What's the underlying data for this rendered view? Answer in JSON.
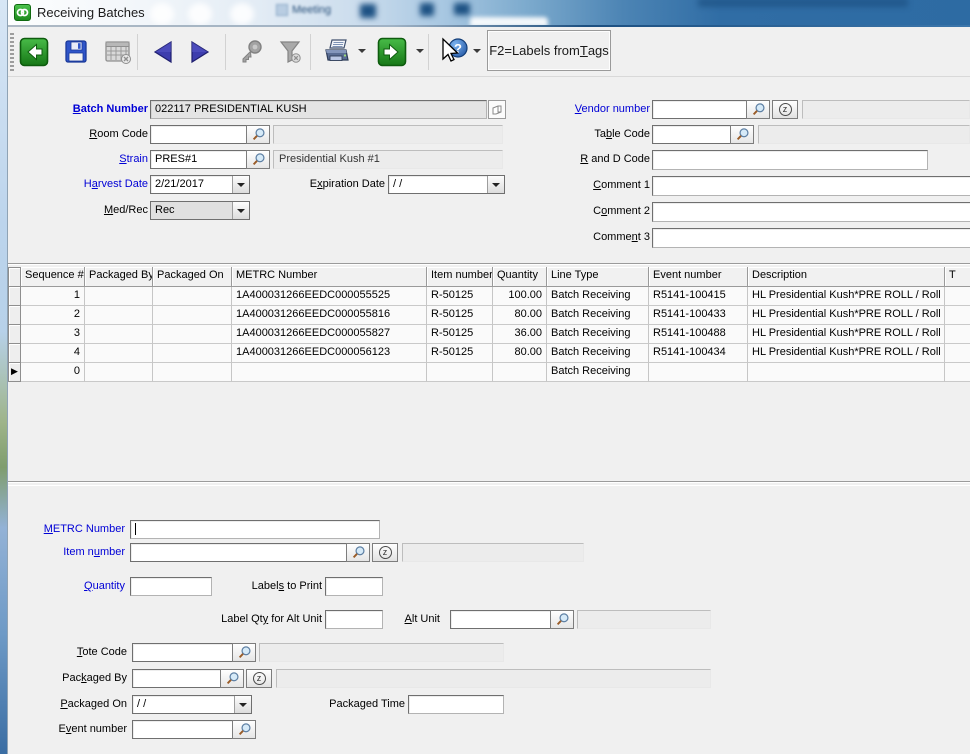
{
  "window": {
    "title": "Receiving Batches"
  },
  "background_window": {
    "label": "Meeting"
  },
  "colors": {
    "label_blue": "#0000d6",
    "titlebar_blue": "#2d6ba3",
    "toolbar_green": "#1d8a1d",
    "nav_triangle_blue": "#3d3dae",
    "disabled_gray": "#9a9a9a",
    "window_bg": "#f0f0f0"
  },
  "toolbar": {
    "f2_label": "F2=Labels from &Tags",
    "buttons": [
      {
        "icon": "back-icon",
        "enabled": true
      },
      {
        "icon": "save-icon",
        "enabled": true
      },
      {
        "icon": "calendar-delete-icon",
        "enabled": false
      },
      {
        "icon": "previous-record-icon",
        "enabled": true
      },
      {
        "icon": "next-record-icon",
        "enabled": true
      },
      {
        "icon": "key-search-icon",
        "enabled": false
      },
      {
        "icon": "filter-icon",
        "enabled": false
      },
      {
        "icon": "print-icon",
        "enabled": true,
        "has_dropdown": true
      },
      {
        "icon": "go-icon",
        "enabled": true,
        "has_dropdown": true
      },
      {
        "icon": "help-select-icon",
        "enabled": true,
        "has_dropdown": true
      }
    ]
  },
  "form_top": {
    "batch_number": {
      "label": "&Batch Number",
      "value": "022117 PRESIDENTIAL KUSH"
    },
    "room_code": {
      "label": "&Room Code",
      "value": "",
      "description": ""
    },
    "strain": {
      "label": "&Strain",
      "value": "PRES#1",
      "description": "Presidential Kush #1"
    },
    "harvest_date": {
      "label": "H&arvest Date",
      "value": "2/21/2017"
    },
    "expiration_date": {
      "label": "E&xpiration Date",
      "value": "/ /"
    },
    "med_rec": {
      "label": "&Med/Rec",
      "value": "Rec"
    },
    "vendor_number": {
      "label": "&Vendor number",
      "value": "",
      "description": ""
    },
    "table_code": {
      "label": "Ta&ble Code",
      "value": "",
      "description": ""
    },
    "r_and_d_code": {
      "label": "&R and D Code",
      "value": ""
    },
    "comment_1": {
      "label": "&Comment 1",
      "value": ""
    },
    "comment_2": {
      "label": "C&omment 2",
      "value": ""
    },
    "comment_3": {
      "label": "Comme&nt 3",
      "value": ""
    }
  },
  "grid": {
    "columns": [
      "Sequence #",
      "Packaged By",
      "Packaged On",
      "METRC Number",
      "Item number",
      "Quantity",
      "Line Type",
      "Event number",
      "Description",
      "T"
    ],
    "current_row_index": 4,
    "current_row_marker": "▶",
    "rows": [
      [
        "1",
        "",
        "",
        "1A400031266EEDC000055525",
        "R-50125",
        "100.00",
        "Batch Receiving",
        "R5141-100415",
        "HL Presidential Kush*PRE ROLL  / Roll",
        ""
      ],
      [
        "2",
        "",
        "",
        "1A400031266EEDC000055816",
        "R-50125",
        "80.00",
        "Batch Receiving",
        "R5141-100433",
        "HL Presidential Kush*PRE ROLL  / Roll",
        ""
      ],
      [
        "3",
        "",
        "",
        "1A400031266EEDC000055827",
        "R-50125",
        "36.00",
        "Batch Receiving",
        "R5141-100488",
        "HL Presidential Kush*PRE ROLL  / Roll",
        ""
      ],
      [
        "4",
        "",
        "",
        "1A400031266EEDC000056123",
        "R-50125",
        "80.00",
        "Batch Receiving",
        "R5141-100434",
        "HL Presidential Kush*PRE ROLL  / Roll",
        ""
      ],
      [
        "0",
        "",
        "",
        "",
        "",
        "",
        "Batch Receiving",
        "",
        "",
        ""
      ]
    ]
  },
  "form_bottom": {
    "metrc_number": {
      "label": "&METRC Number",
      "value": ""
    },
    "item_number": {
      "label": "Item n&umber",
      "value": "",
      "description": ""
    },
    "quantity": {
      "label": "&Quantity",
      "value": ""
    },
    "labels_to_print": {
      "label": "Label&s to Print",
      "value": ""
    },
    "label_qty_alt": {
      "label": "Label Qt&y for Alt Unit",
      "value": ""
    },
    "alt_unit": {
      "label": "&Alt Unit",
      "value": "",
      "description": ""
    },
    "tote_code": {
      "label": "&Tote Code",
      "value": "",
      "description": ""
    },
    "packaged_by": {
      "label": "Pac&kaged By",
      "value": "",
      "description": ""
    },
    "packaged_on": {
      "label": "&Packaged On",
      "value": "/ /"
    },
    "packaged_time": {
      "label": "Packaged Time",
      "value": ""
    },
    "event_number": {
      "label": "E&vent number",
      "value": ""
    }
  }
}
